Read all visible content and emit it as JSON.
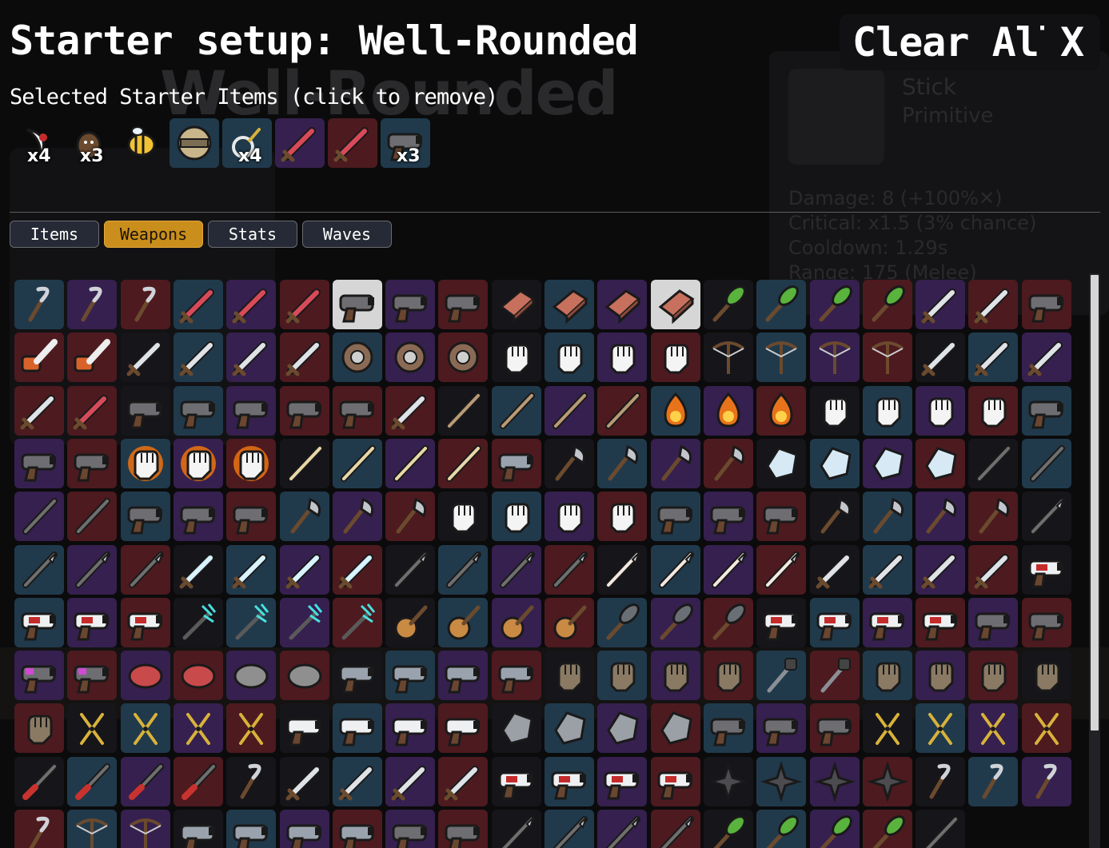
{
  "background": {
    "title": "Well-Rounded",
    "item_name": "Stick",
    "item_tier": "Primitive",
    "stats": [
      "Damage: 8 (+100%✕)",
      "Critical: x1.5 (3% chance)",
      "Cooldown: 1.29s",
      "Range: 175 (Melee)"
    ]
  },
  "header": {
    "title": "Starter setup: Well-Rounded",
    "clear_all": "Clear All",
    "close": "X"
  },
  "selected_label": "Selected Starter Items (click to remove)",
  "starter_items": [
    {
      "icon": "claw-icon",
      "qty": "x4",
      "tier": "none"
    },
    {
      "icon": "potato-icon",
      "qty": "x3",
      "tier": "none"
    },
    {
      "icon": "bee-icon",
      "qty": "",
      "tier": "none"
    },
    {
      "icon": "helmet-icon",
      "qty": "",
      "tier": "t2"
    },
    {
      "icon": "lens-icon",
      "qty": "x4",
      "tier": "t2"
    },
    {
      "icon": "sword-icon",
      "qty": "",
      "tier": "t3"
    },
    {
      "icon": "sword-icon",
      "qty": "",
      "tier": "t4"
    },
    {
      "icon": "pistol-icon",
      "qty": "x3",
      "tier": "t2"
    }
  ],
  "tabs": [
    {
      "label": "Items",
      "active": false
    },
    {
      "label": "Weapons",
      "active": true
    },
    {
      "label": "Stats",
      "active": false
    },
    {
      "label": "Waves",
      "active": false
    }
  ],
  "colors": {
    "t1": "#15151a",
    "t2": "#203a4c",
    "t3": "#36204f",
    "t4": "#4d1a1f",
    "t0": "#d6d6d6",
    "accent": "#c98e1c"
  },
  "weapon_rows": [
    [
      "t2:hook-icon",
      "t3:hook-icon",
      "t4:hook-icon",
      "t2:sword-icon",
      "t3:sword-icon",
      "t4:sword-icon",
      "t0:pistol-icon",
      "t3:pistol-icon",
      "t4:pistol-icon",
      "t1:brick-icon",
      "t2:brick-icon",
      "t3:brick-icon",
      "t0:brick-icon",
      "t1:spiked-club-icon",
      "t2:spiked-club-icon",
      "t3:spiked-club-icon",
      "t4:spiked-club-icon",
      "t3:cutlass-icon",
      "t4:cutlass-icon",
      "t4:drill-gun-icon"
    ],
    [
      "t4:chainsaw-icon",
      "t4:chainsaw-icon",
      "t1:cleaver-icon",
      "t2:cleaver-icon",
      "t3:cleaver-icon",
      "t4:cleaver-icon",
      "t2:sawblade-icon",
      "t3:sawblade-icon",
      "t4:sawblade-icon",
      "t1:claw-glove-icon",
      "t2:claw-glove-icon",
      "t3:claw-glove-icon",
      "t4:claw-glove-icon",
      "t1:crossbow-icon",
      "t2:crossbow-icon",
      "t3:crossbow-icon",
      "t4:crossbow-icon",
      "t1:knife-icon",
      "t2:knife-icon",
      "t3:knife-icon"
    ],
    [
      "t4:knife-icon",
      "t4:ornate-sword-icon",
      "t1:shotgun-icon",
      "t2:shotgun-icon",
      "t3:shotgun-icon",
      "t4:shotgun-icon",
      "t4:taser-icon",
      "t4:dagger-icon",
      "t1:stick-icon",
      "t2:stick-icon",
      "t3:stick-icon",
      "t4:stick-icon",
      "t2:fire-icon",
      "t3:fire-icon",
      "t4:fire-icon",
      "t1:fist-icon",
      "t2:fist-icon",
      "t3:fist-icon",
      "t4:fist-icon",
      "t2:nail-gun-icon"
    ],
    [
      "t3:nail-gun-icon",
      "t4:nail-gun-icon",
      "t2:flame-fist-icon",
      "t3:flame-fist-icon",
      "t4:flame-fist-icon",
      "t1:flute-icon",
      "t2:flute-icon",
      "t3:flute-icon",
      "t4:flute-icon",
      "t4:camera-icon",
      "t1:axe-icon",
      "t2:axe-icon",
      "t3:axe-icon",
      "t4:axe-icon",
      "t1:shard-icon",
      "t2:shard-icon",
      "t3:shard-icon",
      "t4:shard-icon",
      "t1:skull-wand-icon",
      "t2:skull-wand-icon"
    ],
    [
      "t3:skull-wand-icon",
      "t4:skull-wand-icon",
      "t2:blunderbuss-icon",
      "t3:blunderbuss-icon",
      "t4:blunderbuss-icon",
      "t2:hatchet-icon",
      "t3:hatchet-icon",
      "t4:hatchet-icon",
      "t1:hand-icon",
      "t2:hand-icon",
      "t3:hand-icon",
      "t4:hand-icon",
      "t2:blaster-icon",
      "t3:blaster-icon",
      "t4:blaster-icon",
      "t1:pickaxe-icon",
      "t2:pickaxe-icon",
      "t3:pickaxe-icon",
      "t4:pickaxe-icon",
      "t1:spear-icon"
    ],
    [
      "t2:spear-icon",
      "t3:spear-icon",
      "t4:spear-icon",
      "t1:ice-sword-icon",
      "t2:ice-sword-icon",
      "t3:ice-sword-icon",
      "t4:ice-sword-icon",
      "t1:lance-icon",
      "t2:lance-icon",
      "t3:lance-icon",
      "t4:lance-icon",
      "t1:striped-lance-icon",
      "t2:striped-lance-icon",
      "t3:striped-lance-icon",
      "t4:striped-lance-icon",
      "t1:machete-icon",
      "t2:machete-icon",
      "t3:machete-icon",
      "t4:machete-icon",
      "t1:laser-gun-icon"
    ],
    [
      "t2:laser-gun-icon",
      "t3:laser-gun-icon",
      "t4:laser-gun-icon",
      "t1:thunder-staff-icon",
      "t2:thunder-staff-icon",
      "t3:thunder-staff-icon",
      "t4:thunder-staff-icon",
      "t1:lute-icon",
      "t2:lute-icon",
      "t3:lute-icon",
      "t4:lute-icon",
      "t2:mace-icon",
      "t3:mace-icon",
      "t4:mace-icon",
      "t1:medic-gun-icon",
      "t2:medic-gun-icon",
      "t3:medic-gun-icon",
      "t4:medic-gun-icon",
      "t3:minigun-icon",
      "t4:minigun-icon"
    ],
    [
      "t3:hair-dryer-icon",
      "t4:hair-dryer-icon",
      "t3:dragon-icon",
      "t4:dragon-icon",
      "t3:coil-icon",
      "t4:coil-icon",
      "t1:raygun-icon",
      "t2:raygun-icon",
      "t3:raygun-icon",
      "t4:raygun-icon",
      "t1:cannon-fist-icon",
      "t2:cannon-fist-icon",
      "t3:cannon-fist-icon",
      "t4:cannon-fist-icon",
      "t2:plunger-icon",
      "t4:plunger-icon",
      "t2:rocket-fist-icon",
      "t3:rocket-fist-icon",
      "t4:rocket-fist-icon",
      "t1:power-fist-icon"
    ],
    [
      "t4:power-fist-icon",
      "t1:pruner-icon",
      "t2:pruner-icon",
      "t3:pruner-icon",
      "t4:pruner-icon",
      "t1:revolver-icon",
      "t2:revolver-icon",
      "t3:revolver-icon",
      "t4:revolver-icon",
      "t1:rock-icon",
      "t2:rock-icon",
      "t3:rock-icon",
      "t4:rock-icon",
      "t2:rocket-launcher-icon",
      "t3:rocket-launcher-icon",
      "t4:rocket-launcher-icon",
      "t1:scissors-icon",
      "t2:scissors-icon",
      "t3:scissors-icon",
      "t4:scissors-icon"
    ],
    [
      "t1:screwdriver-icon",
      "t2:screwdriver-icon",
      "t3:screwdriver-icon",
      "t4:screwdriver-icon",
      "t1:scythe-icon",
      "t1:bloody-knife-icon",
      "t2:bloody-knife-icon",
      "t3:bloody-knife-icon",
      "t4:bloody-knife-icon",
      "t1:megaphone-icon",
      "t2:megaphone-icon",
      "t3:megaphone-icon",
      "t4:megaphone-icon",
      "t1:shuriken-icon",
      "t2:shuriken-icon",
      "t3:shuriken-icon",
      "t4:shuriken-icon",
      "t1:sickle-icon",
      "t2:sickle-icon",
      "t3:sickle-icon"
    ],
    [
      "t4:sickle-icon",
      "t2:slingshot-icon",
      "t3:slingshot-icon",
      "t1:smg-icon",
      "t2:smg-icon",
      "t3:smg-icon",
      "t4:smg-icon",
      "t3:camcorder-icon",
      "t4:camcorder-icon",
      "t1:spear-tip-icon",
      "t2:spear-tip-icon",
      "t3:spear-tip-icon",
      "t4:spear-tip-icon",
      "t1:spiked-shield-icon",
      "t2:spiked-shield-icon",
      "t3:spiked-shield-icon",
      "t4:spiked-shield-icon",
      "t1:wand-icon"
    ]
  ]
}
